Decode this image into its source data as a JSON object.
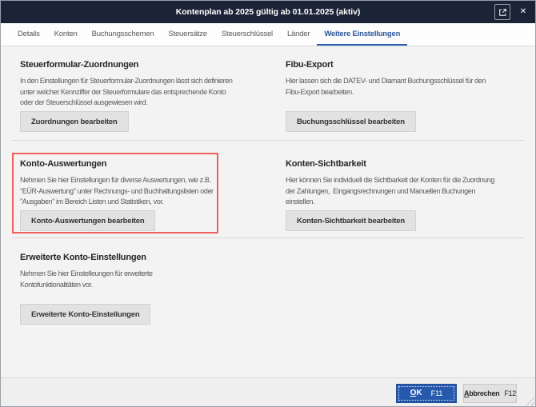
{
  "window": {
    "title": "Kontenplan ab 2025 gültig ab 01.01.2025 (aktiv)"
  },
  "tabs": [
    {
      "label": "Details",
      "active": false
    },
    {
      "label": "Konten",
      "active": false
    },
    {
      "label": "Buchungsschemen",
      "active": false
    },
    {
      "label": "Steuersätze",
      "active": false
    },
    {
      "label": "Steuerschlüssel",
      "active": false
    },
    {
      "label": "Länder",
      "active": false
    },
    {
      "label": "Weitere Einstellungen",
      "active": true
    }
  ],
  "sections": [
    {
      "title": "Steuerformular-Zuordnungen",
      "description": "In den Einstellungen für Steuerformular-Zuordnungen lässt sich definieren\nunter welcher Kennziffer der Steuerformulare das entsprechende Konto\noder der Steuerschlüssel ausgewiesen wird.",
      "button_label": "Zuordnungen bearbeiten"
    },
    {
      "title": "Fibu-Export",
      "description": "Hier lassen sich die DATEV- und Diamant Buchungsschlüssel für den\nFibu-Export bearbeiten.",
      "button_label": "Buchungsschlüssel bearbeiten"
    },
    {
      "title": "Konto-Auswertungen",
      "description": "Nehmen Sie hier Einstellungen für diverse Auswertungen, wie z.B.\n\"EÜR-Auswertung\" unter Rechnungs- und Buchhaltungslisten oder\n\"Ausgaben\" im Bereich Listen und Statistiken, vor.",
      "button_label": "Konto-Auswertungen bearbeiten",
      "highlighted": true
    },
    {
      "title": "Konten-Sichtbarkeit",
      "description": "Hier können Sie individuell die Sichtbarkeit der Konten für die Zuordnung\nder Zahlungen,  Eingangsrechnungen und Manuellen Buchungen\neinstellen.",
      "button_label": "Konten-Sichtbarkeit bearbeiten"
    },
    {
      "title": "Erweiterte Konto-Einstellungen",
      "description": "Nehmen Sie hier Einstelleungen für erweiterte\nKontofunktionalitäten vor.",
      "button_label": "Erweiterte Konto-Einstellungen"
    }
  ],
  "footer": {
    "ok_label": "OK",
    "ok_key": "F11",
    "cancel_label": "Abbrechen",
    "cancel_key": "F12"
  },
  "icons": {
    "popout": "open-in-new-window-icon",
    "close": "close-icon"
  },
  "colors": {
    "titlebar": "#1b2337",
    "accent_blue": "#2b579a",
    "ok_button": "#2659ae",
    "highlight_red": "#ee5f5b",
    "content_background": "#f3f3f3"
  }
}
